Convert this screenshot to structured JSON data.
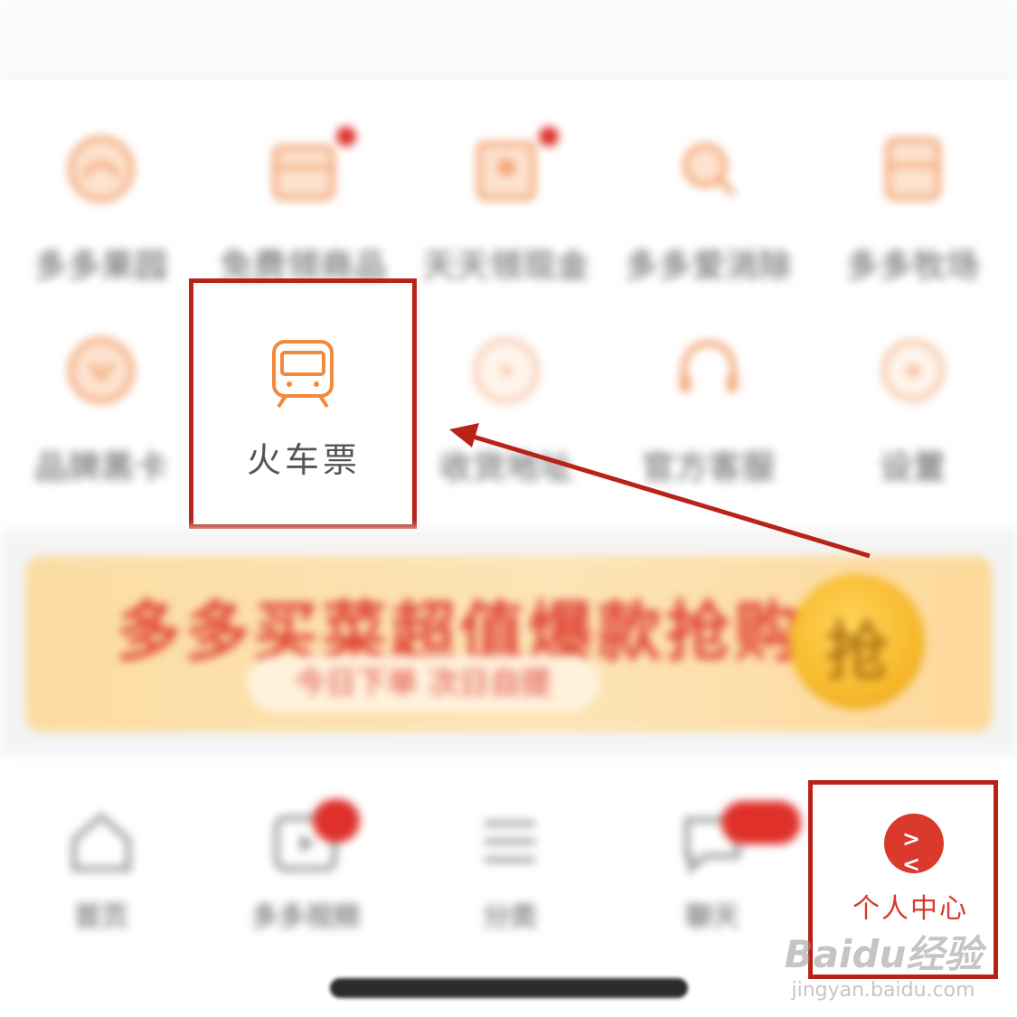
{
  "grid": {
    "row1": [
      {
        "label": "多多果园",
        "icon": "fruit-bowl-icon"
      },
      {
        "label": "免费领商品",
        "icon": "gift-box-icon",
        "badge": true
      },
      {
        "label": "天天领现金",
        "icon": "cash-envelope-icon",
        "badge": true
      },
      {
        "label": "多多爱消除",
        "icon": "search-game-icon"
      },
      {
        "label": "多多牧场",
        "icon": "pasture-icon"
      }
    ],
    "row2": [
      {
        "label": "品牌黑卡",
        "icon": "vip-card-icon"
      },
      {
        "label": "火车票",
        "icon": "train-icon"
      },
      {
        "label": "收货地址",
        "icon": "address-icon"
      },
      {
        "label": "官方客服",
        "icon": "headset-icon"
      },
      {
        "label": "设置",
        "icon": "settings-icon"
      }
    ]
  },
  "banner": {
    "headline": "多多买菜超值爆款抢购中",
    "subtext": "今日下单 次日自提",
    "button": "抢"
  },
  "tabbar": {
    "tabs": [
      {
        "label": "首页",
        "icon": "home-icon"
      },
      {
        "label": "多多视频",
        "icon": "video-icon",
        "badge": true
      },
      {
        "label": "分类",
        "icon": "menu-lines-icon"
      },
      {
        "label": "聊天",
        "icon": "chat-icon",
        "badge": true
      },
      {
        "label": "个人中心",
        "icon": "profile-avatar-icon",
        "active": true
      }
    ]
  },
  "watermark": {
    "line1": "Baidu经验",
    "line2": "jingyan.baidu.com"
  },
  "colors": {
    "accent": "#d93a2c",
    "annotation": "#b92217",
    "icon_orange": "#f08a3c"
  }
}
